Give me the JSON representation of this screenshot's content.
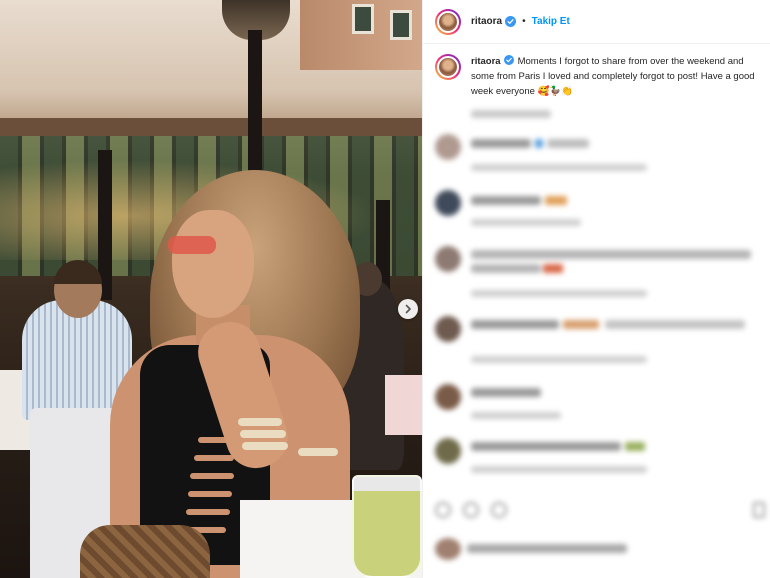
{
  "post": {
    "username": "ritaora",
    "follow_label": "Takip Et",
    "separator": "•",
    "caption": "Moments I forgot to share from over the weekend and some from Paris I loved and completely forgot to post! Have a good week everyone 🥰🦆👏"
  },
  "colors": {
    "follow_blue": "#0095f6",
    "verified_blue": "#3897f0",
    "text": "#262626"
  },
  "icons": {
    "verified": "verified-badge-icon",
    "next": "chevron-right-icon"
  }
}
